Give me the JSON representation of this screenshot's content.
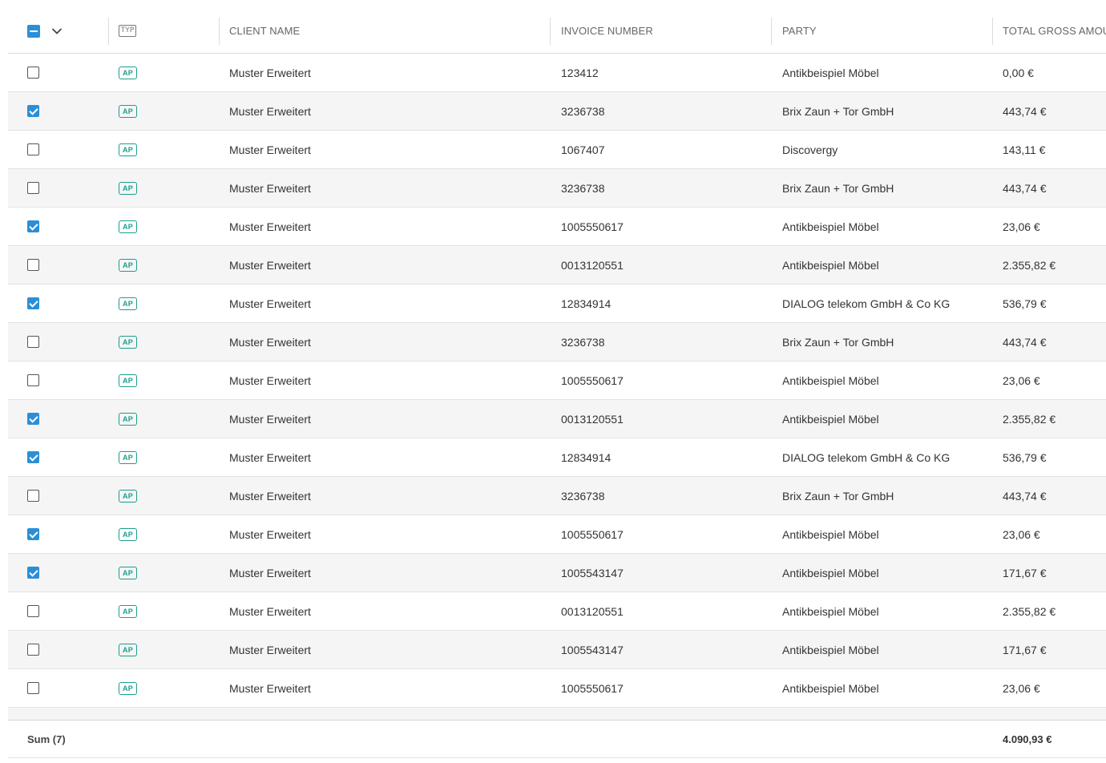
{
  "columns": {
    "type": "TYP",
    "client": "CLIENT NAME",
    "invoice": "INVOICE NUMBER",
    "party": "PARTY",
    "amount": "TOTAL GROSS AMOUNT"
  },
  "master_checkbox_state": "indeterminate",
  "rows": [
    {
      "checked": false,
      "type": "AP",
      "client": "Muster Erweitert",
      "invoice": "123412",
      "party": "Antikbeispiel Möbel",
      "amount": "0,00 €"
    },
    {
      "checked": true,
      "type": "AP",
      "client": "Muster Erweitert",
      "invoice": "3236738",
      "party": "Brix Zaun + Tor GmbH",
      "amount": "443,74 €"
    },
    {
      "checked": false,
      "type": "AP",
      "client": "Muster Erweitert",
      "invoice": "1067407",
      "party": "Discovergy",
      "amount": "143,11 €"
    },
    {
      "checked": false,
      "type": "AP",
      "client": "Muster Erweitert",
      "invoice": "3236738",
      "party": "Brix Zaun + Tor GmbH",
      "amount": "443,74 €"
    },
    {
      "checked": true,
      "type": "AP",
      "client": "Muster Erweitert",
      "invoice": "1005550617",
      "party": "Antikbeispiel Möbel",
      "amount": "23,06 €"
    },
    {
      "checked": false,
      "type": "AP",
      "client": "Muster Erweitert",
      "invoice": "0013120551",
      "party": "Antikbeispiel Möbel",
      "amount": "2.355,82 €"
    },
    {
      "checked": true,
      "type": "AP",
      "client": "Muster Erweitert",
      "invoice": "12834914",
      "party": "DIALOG telekom GmbH & Co KG",
      "amount": "536,79 €"
    },
    {
      "checked": false,
      "type": "AP",
      "client": "Muster Erweitert",
      "invoice": "3236738",
      "party": "Brix Zaun + Tor GmbH",
      "amount": "443,74 €"
    },
    {
      "checked": false,
      "type": "AP",
      "client": "Muster Erweitert",
      "invoice": "1005550617",
      "party": "Antikbeispiel Möbel",
      "amount": "23,06 €"
    },
    {
      "checked": true,
      "type": "AP",
      "client": "Muster Erweitert",
      "invoice": "0013120551",
      "party": "Antikbeispiel Möbel",
      "amount": "2.355,82 €"
    },
    {
      "checked": true,
      "type": "AP",
      "client": "Muster Erweitert",
      "invoice": "12834914",
      "party": "DIALOG telekom GmbH & Co KG",
      "amount": "536,79 €"
    },
    {
      "checked": false,
      "type": "AP",
      "client": "Muster Erweitert",
      "invoice": "3236738",
      "party": "Brix Zaun + Tor GmbH",
      "amount": "443,74 €"
    },
    {
      "checked": true,
      "type": "AP",
      "client": "Muster Erweitert",
      "invoice": "1005550617",
      "party": "Antikbeispiel Möbel",
      "amount": "23,06 €"
    },
    {
      "checked": true,
      "type": "AP",
      "client": "Muster Erweitert",
      "invoice": "1005543147",
      "party": "Antikbeispiel Möbel",
      "amount": "171,67 €"
    },
    {
      "checked": false,
      "type": "AP",
      "client": "Muster Erweitert",
      "invoice": "0013120551",
      "party": "Antikbeispiel Möbel",
      "amount": "2.355,82 €"
    },
    {
      "checked": false,
      "type": "AP",
      "client": "Muster Erweitert",
      "invoice": "1005543147",
      "party": "Antikbeispiel Möbel",
      "amount": "171,67 €"
    },
    {
      "checked": false,
      "type": "AP",
      "client": "Muster Erweitert",
      "invoice": "1005550617",
      "party": "Antikbeispiel Möbel",
      "amount": "23,06 €"
    }
  ],
  "footer": {
    "sum_label": "Sum (7)",
    "sum_amount": "4.090,93 €"
  },
  "colors": {
    "accent_blue": "#2b8fd6",
    "ap_badge_teal": "#1b9e8c",
    "row_alt_bg": "#f5f5f5"
  },
  "icons": {
    "master_checkbox": "indeterminate-checkbox-icon",
    "master_menu": "chevron-down-icon",
    "type_header": "document-type-icon"
  }
}
